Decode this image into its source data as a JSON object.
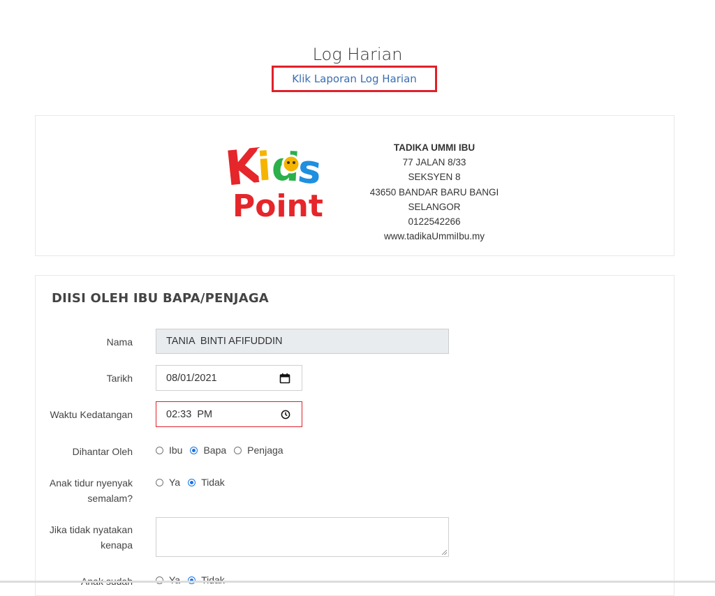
{
  "header": {
    "title": "Log Harian",
    "report_link": "Klik Laporan Log Harian"
  },
  "school": {
    "logo_alt": "Kids Point",
    "name": "TADIKA UMMI IBU",
    "address_lines": [
      "77 JALAN 8/33",
      "SEKSYEN 8",
      "43650 BANDAR BARU BANGI",
      "SELANGOR"
    ],
    "phone": "0122542266",
    "website": "www.tadikaUmmiIbu.my"
  },
  "form": {
    "section_title": "DIISI OLEH IBU BAPA/PENJAGA",
    "nama": {
      "label": "Nama",
      "value": "TANIA  BINTI AFIFUDDIN"
    },
    "tarikh": {
      "label": "Tarikh",
      "value": "08/01/2021",
      "icon": "calendar-icon"
    },
    "waktu": {
      "label": "Waktu Kedatangan",
      "value": "02:33  PM",
      "icon": "clock-icon"
    },
    "dihantar": {
      "label": "Dihantar Oleh",
      "options": [
        "Ibu",
        "Bapa",
        "Penjaga"
      ],
      "selected": "Bapa"
    },
    "tidur": {
      "label_1": "Anak tidur nyenyak",
      "label_2": "semalam?",
      "options": [
        "Ya",
        "Tidak"
      ],
      "selected": "Tidak"
    },
    "kenapa": {
      "label_1": "Jika tidak nyatakan",
      "label_2": "kenapa",
      "value": ""
    },
    "sudah": {
      "label": "Anak sudah",
      "options": [
        "Ya",
        "Tidak"
      ],
      "selected": "Tidak"
    }
  },
  "colors": {
    "link": "#3a6fb0",
    "highlight": "#e0202a",
    "radio": "#1a73e8"
  }
}
